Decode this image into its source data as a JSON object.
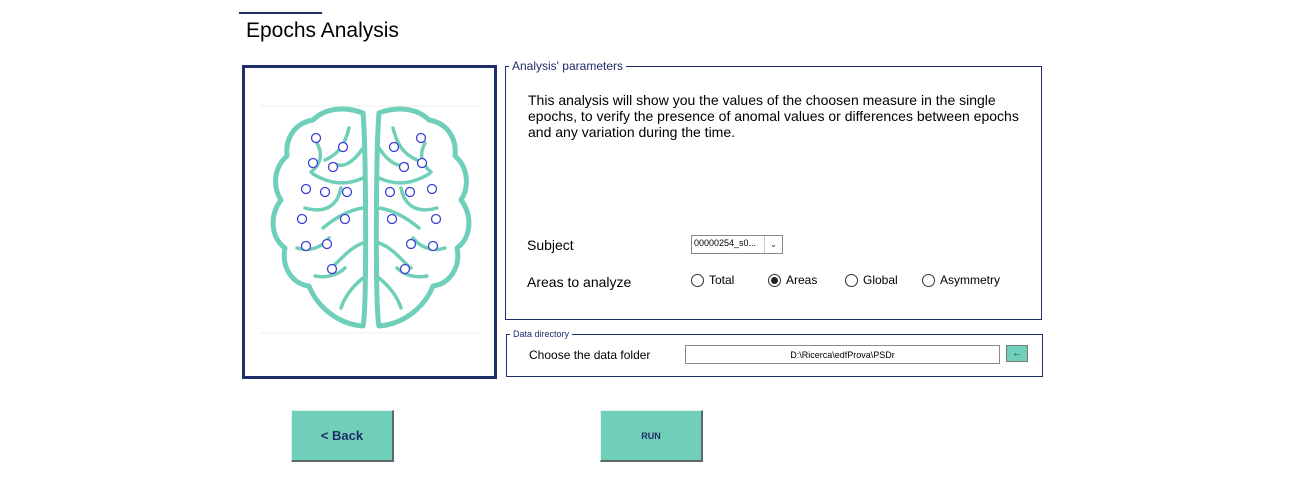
{
  "header": {
    "title": "Epochs Analysis"
  },
  "params": {
    "legend": "Analysis' parameters",
    "description": "This analysis will show you the values of the choosen measure in the single epochs, to verify the presence of anomal values or differences between epochs and any variation during the time.",
    "subject_label": "Subject",
    "subject_value": "00000254_s0...",
    "areas_label": "Areas to analyze",
    "area_options": [
      {
        "label": "Total",
        "checked": false
      },
      {
        "label": "Areas",
        "checked": true
      },
      {
        "label": "Global",
        "checked": false
      },
      {
        "label": "Asymmetry",
        "checked": false
      }
    ]
  },
  "data_dir": {
    "legend": "Data directory",
    "label": "Choose the data folder",
    "path": "D:\\Ricerca\\edfProva\\PSDr",
    "browse_glyph": "←"
  },
  "buttons": {
    "back": "< Back",
    "run": "RUN"
  },
  "colors": {
    "accent": "#6fcfb8",
    "navy": "#1f2d6b",
    "brain": "#6fcfb8",
    "electrode": "#3a3fd6"
  },
  "icons": {
    "brain": "brain-electrodes-icon",
    "combo_arrow": "chevron-down-icon",
    "browse": "arrow-left-icon"
  }
}
